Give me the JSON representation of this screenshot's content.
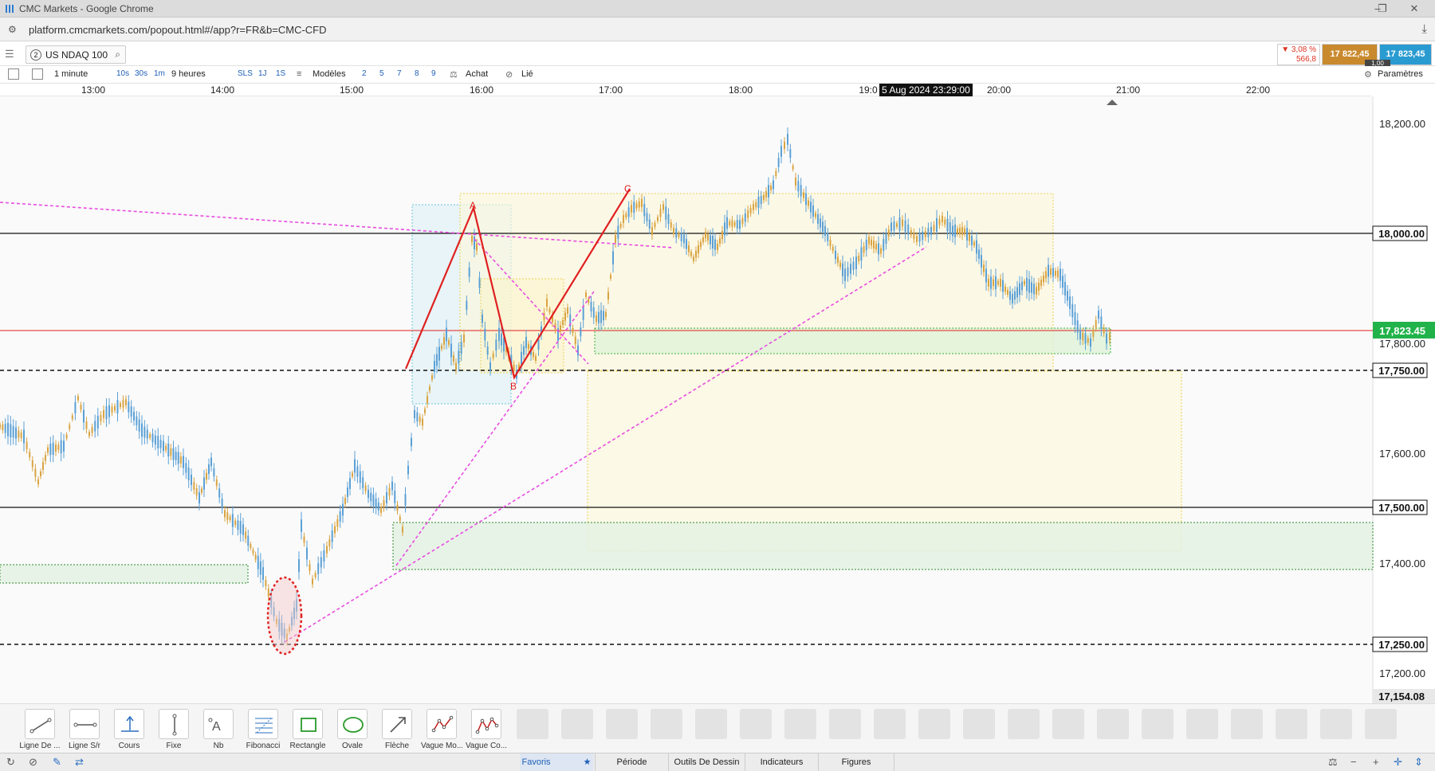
{
  "window": {
    "title": "CMC Markets - Google Chrome",
    "url": "platform.cmcmarkets.com/popout.html#/app?r=FR&b=CMC-CFD"
  },
  "instrument": {
    "badge": "2",
    "name": "US NDAQ 100"
  },
  "quote": {
    "change_pct": "▼ 3,08 %",
    "change_pts": "566,8",
    "sell": "17 822,45",
    "buy": "17 823,45",
    "spread": "1,00"
  },
  "toolbar": {
    "interval": "1 minute",
    "quick_intervals": [
      "10s",
      "30s",
      "1m"
    ],
    "range": "9 heures",
    "buttons": [
      "SLS",
      "1J",
      "1S"
    ],
    "models": "Modèles",
    "model_nums": [
      "2",
      "5",
      "7",
      "8",
      "9"
    ],
    "buy": "Achat",
    "linked": "Lié",
    "settings": "Paramètres"
  },
  "time_axis": {
    "labels": [
      "13:00",
      "14:00",
      "15:00",
      "16:00",
      "17:00",
      "18:00",
      "19:0",
      "20:00",
      "21:00",
      "22:00"
    ],
    "cursor": "5 Aug 2024 23:29:00"
  },
  "price_axis": {
    "ticks": [
      "18,200.00",
      "17,800.00",
      "17,600.00",
      "17,400.00",
      "17,200.00"
    ],
    "line_labels": [
      "18,000.00",
      "17,750.00",
      "17,500.00",
      "17,250.00"
    ],
    "current": "17,823.45",
    "low_label": "17,154.08"
  },
  "pattern_labels": [
    "A",
    "B",
    "C"
  ],
  "drawing_tools": [
    {
      "label": "Ligne De ...",
      "icon": "trend-line-icon"
    },
    {
      "label": "Ligne S/r",
      "icon": "sr-line-icon"
    },
    {
      "label": "Cours",
      "icon": "price-line-icon"
    },
    {
      "label": "Fixe",
      "icon": "vertical-line-icon"
    },
    {
      "label": "Nb",
      "icon": "text-icon"
    },
    {
      "label": "Fibonacci",
      "icon": "fibonacci-icon"
    },
    {
      "label": "Rectangle",
      "icon": "rectangle-icon"
    },
    {
      "label": "Ovale",
      "icon": "oval-icon"
    },
    {
      "label": "Flèche",
      "icon": "arrow-icon"
    },
    {
      "label": "Vague Mo...",
      "icon": "wave-mo-icon"
    },
    {
      "label": "Vague Co...",
      "icon": "wave-co-icon"
    }
  ],
  "bottom_tabs": [
    "Favoris",
    "Période",
    "Outils De Dessin",
    "Indicateurs",
    "Figures"
  ],
  "colors": {
    "bid": "#c98a2d",
    "ask": "#2a9bd1",
    "current_price": "#21b34a",
    "pattern": "#e02020",
    "trendline": "#e84de0"
  }
}
